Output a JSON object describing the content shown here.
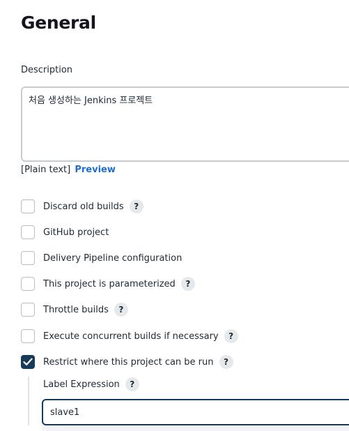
{
  "section": {
    "title": "General"
  },
  "description": {
    "label": "Description",
    "value": "처음 생성하는 Jenkins 프로젝트",
    "format_prefix": "[Plain text]",
    "preview_link": "Preview"
  },
  "options": [
    {
      "label": "Discard old builds",
      "checked": false,
      "help": "?"
    },
    {
      "label": "GitHub project",
      "checked": false,
      "help": ""
    },
    {
      "label": "Delivery Pipeline configuration",
      "checked": false,
      "help": ""
    },
    {
      "label": "This project is parameterized",
      "checked": false,
      "help": "?"
    },
    {
      "label": "Throttle builds",
      "checked": false,
      "help": "?"
    },
    {
      "label": "Execute concurrent builds if necessary",
      "checked": false,
      "help": "?"
    },
    {
      "label": "Restrict where this project can be run",
      "checked": true,
      "help": "?"
    }
  ],
  "restrict": {
    "label_expression": "Label Expression",
    "help": "?",
    "value": "slave1"
  },
  "colors": {
    "accent_dark": "#163a59",
    "link": "#1e6dd0"
  }
}
